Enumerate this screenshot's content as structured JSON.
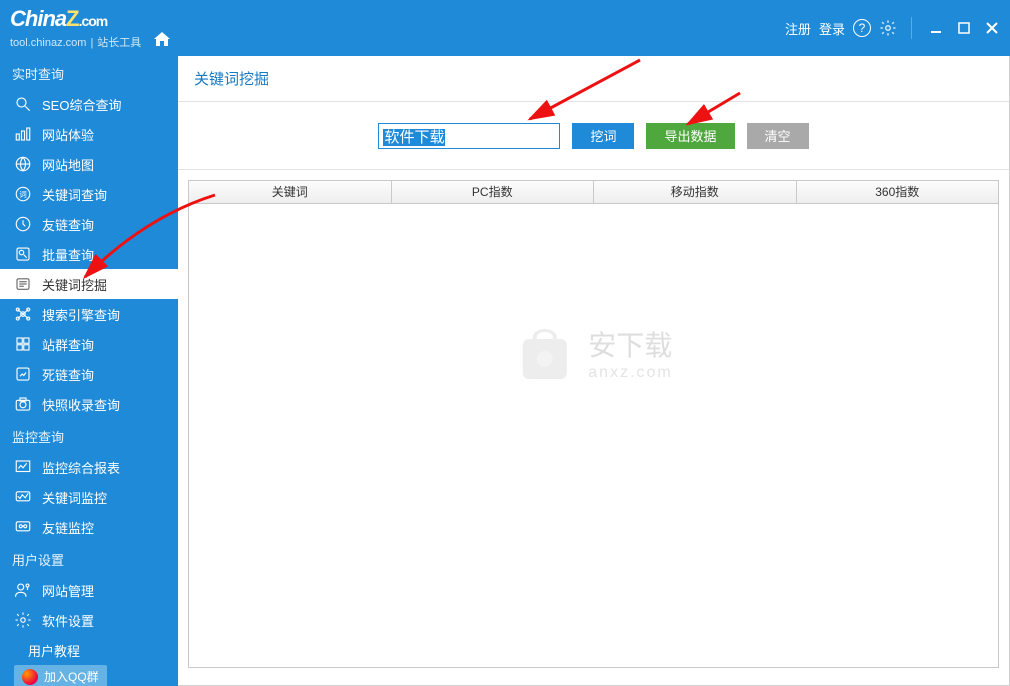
{
  "titlebar": {
    "logo_main": "China",
    "logo_z": "Z",
    "logo_com": ".com",
    "sub_domain": "tool.chinaz.com",
    "sub_title": "站长工具",
    "register": "注册",
    "login": "登录"
  },
  "sidebar": {
    "section1": "实时查询",
    "items1": [
      {
        "label": "SEO综合查询",
        "name": "sidebar-item-seo"
      },
      {
        "label": "网站体验",
        "name": "sidebar-item-experience"
      },
      {
        "label": "网站地图",
        "name": "sidebar-item-sitemap"
      },
      {
        "label": "关键词查询",
        "name": "sidebar-item-keyword-query"
      },
      {
        "label": "友链查询",
        "name": "sidebar-item-friendlink"
      },
      {
        "label": "批量查询",
        "name": "sidebar-item-batch"
      },
      {
        "label": "关键词挖掘",
        "name": "sidebar-item-keyword-mining",
        "active": true
      },
      {
        "label": "搜索引擎查询",
        "name": "sidebar-item-searchengine"
      },
      {
        "label": "站群查询",
        "name": "sidebar-item-sitegroup"
      },
      {
        "label": "死链查询",
        "name": "sidebar-item-deadlink"
      },
      {
        "label": "快照收录查询",
        "name": "sidebar-item-snapshot"
      }
    ],
    "section2": "监控查询",
    "items2": [
      {
        "label": "监控综合报表",
        "name": "sidebar-item-monitor-report"
      },
      {
        "label": "关键词监控",
        "name": "sidebar-item-keyword-monitor"
      },
      {
        "label": "友链监控",
        "name": "sidebar-item-link-monitor"
      }
    ],
    "section3": "用户设置",
    "items3": [
      {
        "label": "网站管理",
        "name": "sidebar-item-site-manage"
      },
      {
        "label": "软件设置",
        "name": "sidebar-item-settings"
      },
      {
        "label": "用户教程",
        "name": "sidebar-item-tutorial",
        "noicon": true
      }
    ],
    "qq_label": "加入QQ群"
  },
  "main": {
    "title": "关键词挖掘",
    "input_value": "软件下载",
    "btn_mine": "挖词",
    "btn_export": "导出数据",
    "btn_clear": "清空",
    "columns": [
      "关键词",
      "PC指数",
      "移动指数",
      "360指数"
    ]
  },
  "watermark": {
    "cn": "安下载",
    "en": "anxz.com"
  }
}
